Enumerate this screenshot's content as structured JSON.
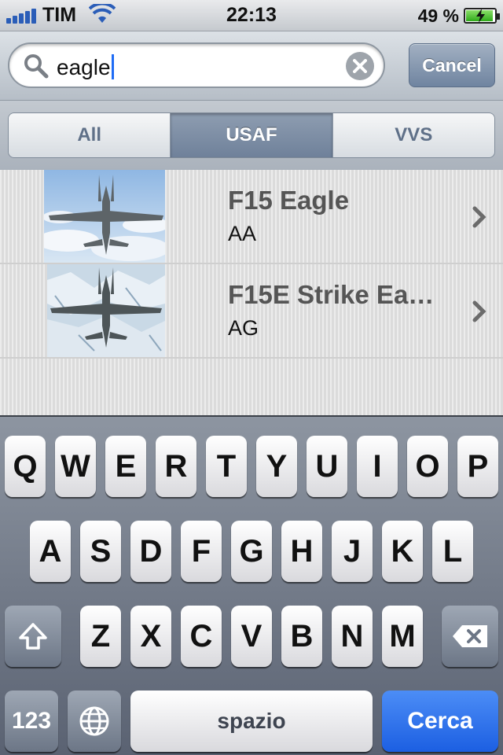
{
  "status_bar": {
    "carrier": "TIM",
    "time": "22:13",
    "battery": "49 %"
  },
  "search": {
    "query": "eagle",
    "cancel_label": "Cancel"
  },
  "scope": {
    "segments": [
      "All",
      "USAF",
      "VVS"
    ],
    "selected": "USAF"
  },
  "results": [
    {
      "title": "F15 Eagle",
      "subtitle": "AA"
    },
    {
      "title": "F15E Strike Ea…",
      "subtitle": "AG"
    }
  ],
  "keyboard": {
    "row1": [
      "Q",
      "W",
      "E",
      "R",
      "T",
      "Y",
      "U",
      "I",
      "O",
      "P"
    ],
    "row2": [
      "A",
      "S",
      "D",
      "F",
      "G",
      "H",
      "J",
      "K",
      "L"
    ],
    "row3": [
      "Z",
      "X",
      "C",
      "V",
      "B",
      "N",
      "M"
    ],
    "numbers_label": "123",
    "space_label": "spazio",
    "return_label": "Cerca"
  },
  "colors": {
    "accent": "#1c5fe2",
    "selected_segment": "#6f819a",
    "battery": "#2eaa1a"
  },
  "icons": [
    "signal-icon",
    "wifi-icon",
    "battery-icon",
    "search-icon",
    "clear-icon",
    "chevron-right-icon",
    "shift-icon",
    "globe-icon",
    "backspace-icon"
  ]
}
